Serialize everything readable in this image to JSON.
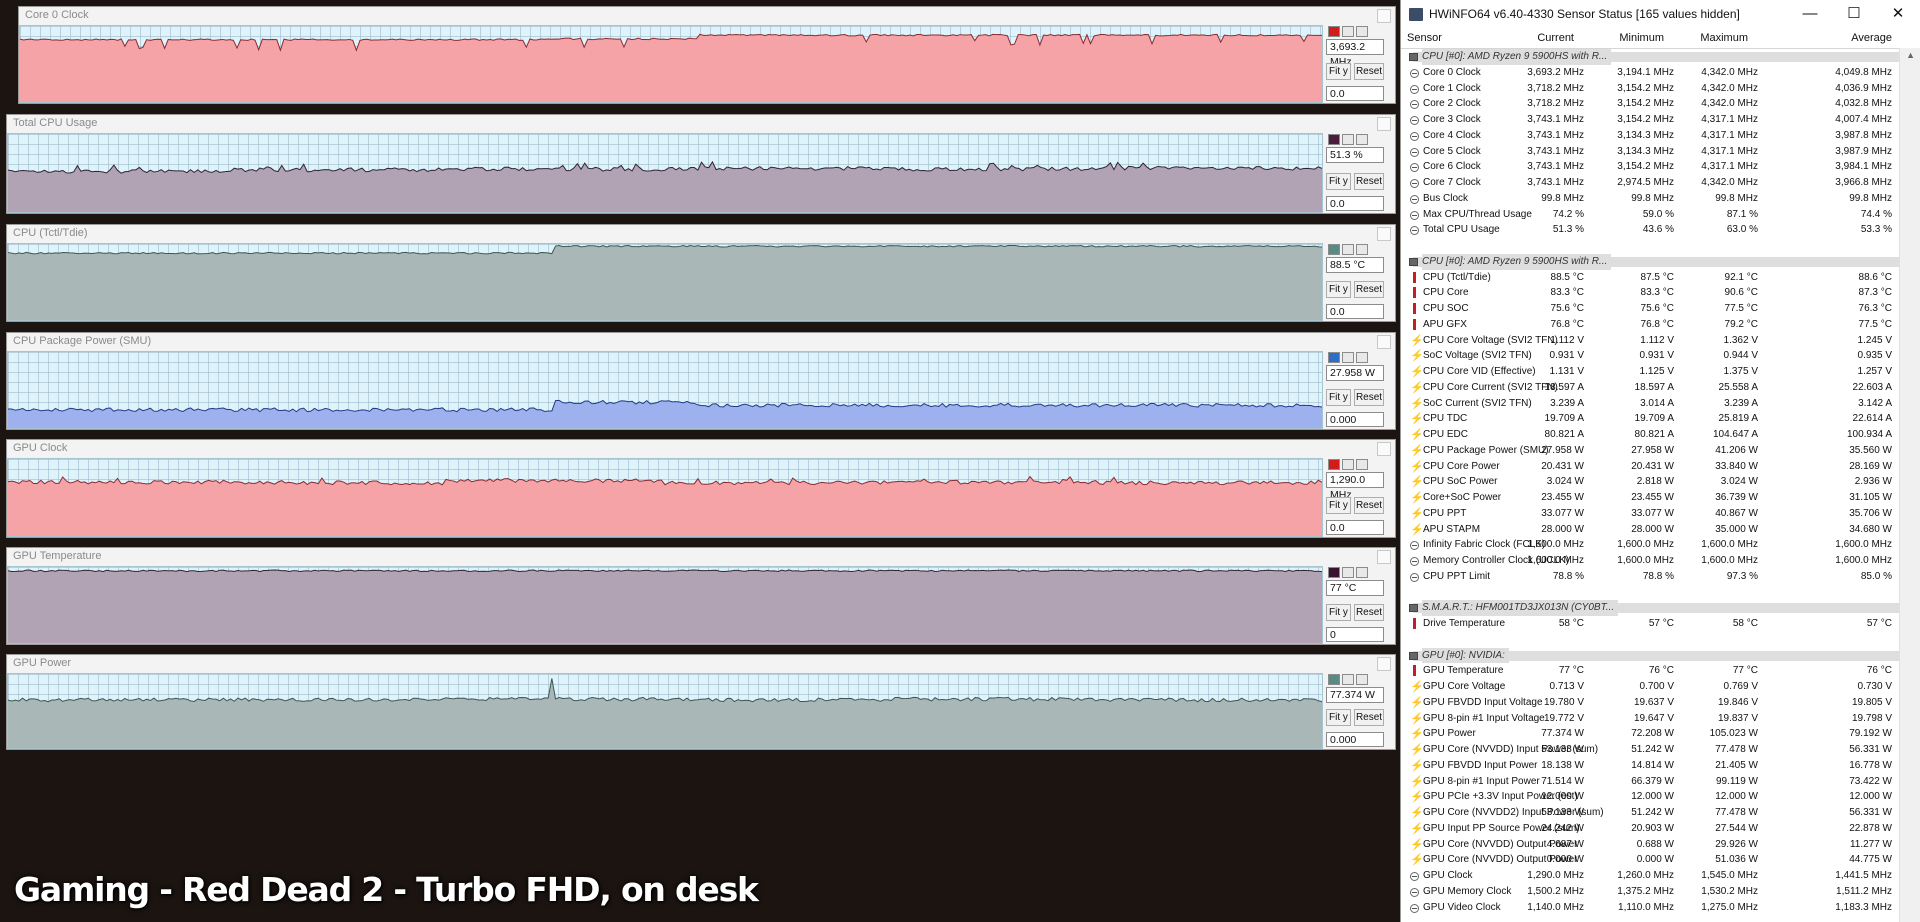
{
  "graphs": [
    {
      "title": "Core 0 Clock",
      "current": "3,693.2 MHz",
      "min": "0.0",
      "color": "#f5a3a6",
      "line": "#8a2b30",
      "swatch": "#d21c1c",
      "level": [
        0.18,
        0.18,
        0.17,
        0.11,
        0.12,
        0.12
      ]
    },
    {
      "title": "Total CPU Usage",
      "current": "51.3 %",
      "min": "0.0",
      "color": "#b2a3b4",
      "line": "#2e2434",
      "swatch": "#4a1e3a",
      "level": [
        0.48,
        0.46,
        0.45,
        0.44,
        0.45,
        0.44
      ]
    },
    {
      "title": "CPU (Tctl/Tdie)",
      "current": "88.5 °C",
      "min": "0.0",
      "color": "#a9b8b7",
      "line": "#3c5654",
      "swatch": "#5a8a86",
      "level": [
        0.12,
        0.11,
        0.03,
        0.02,
        0.03,
        0.03
      ]
    },
    {
      "title": "CPU Package Power (SMU)",
      "current": "27.958 W",
      "min": "0.000",
      "color": "#9db1ee",
      "line": "#233a88",
      "swatch": "#2e6ec6",
      "level": [
        0.76,
        0.76,
        0.66,
        0.7,
        0.7,
        0.71
      ]
    },
    {
      "title": "GPU Clock",
      "current": "1,290.0 MHz",
      "min": "0.0",
      "color": "#f5a3a6",
      "line": "#8a2b30",
      "swatch": "#d21c1c",
      "level": [
        0.3,
        0.31,
        0.28,
        0.31,
        0.3,
        0.31
      ]
    },
    {
      "title": "GPU Temperature",
      "current": "77 °C",
      "min": "0",
      "color": "#b2a3b4",
      "line": "#2e2434",
      "swatch": "#3a1230",
      "level": [
        0.05,
        0.05,
        0.05,
        0.05,
        0.05,
        0.05
      ]
    },
    {
      "title": "GPU Power",
      "current": "77.374 W",
      "min": "0.000",
      "color": "#a9b8b7",
      "line": "#3c5654",
      "swatch": "#5a8a86",
      "level": [
        0.35,
        0.35,
        0.34,
        0.35,
        0.34,
        0.35
      ]
    }
  ],
  "graph_buttons": {
    "fit": "Fit y",
    "reset": "Reset"
  },
  "caption": "Gaming - Red Dead 2 - Turbo FHD, on desk",
  "sensor": {
    "title": "HWiNFO64 v6.40-4330 Sensor Status [165 values hidden]",
    "columns": [
      "Sensor",
      "Current",
      "Minimum",
      "Maximum",
      "Average"
    ],
    "rows": [
      {
        "g": "CPU [#0]: AMD Ryzen 9 5900HS with R..."
      },
      {
        "n": "Core 0 Clock",
        "i": "clock",
        "v": [
          "3,693.2 MHz",
          "3,194.1 MHz",
          "4,342.0 MHz",
          "4,049.8 MHz"
        ]
      },
      {
        "n": "Core 1 Clock",
        "i": "clock",
        "v": [
          "3,718.2 MHz",
          "3,154.2 MHz",
          "4,342.0 MHz",
          "4,036.9 MHz"
        ]
      },
      {
        "n": "Core 2 Clock",
        "i": "clock",
        "v": [
          "3,718.2 MHz",
          "3,154.2 MHz",
          "4,342.0 MHz",
          "4,032.8 MHz"
        ]
      },
      {
        "n": "Core 3 Clock",
        "i": "clock",
        "v": [
          "3,743.1 MHz",
          "3,154.2 MHz",
          "4,317.1 MHz",
          "4,007.4 MHz"
        ]
      },
      {
        "n": "Core 4 Clock",
        "i": "clock",
        "v": [
          "3,743.1 MHz",
          "3,134.3 MHz",
          "4,317.1 MHz",
          "3,987.8 MHz"
        ]
      },
      {
        "n": "Core 5 Clock",
        "i": "clock",
        "v": [
          "3,743.1 MHz",
          "3,134.3 MHz",
          "4,317.1 MHz",
          "3,987.9 MHz"
        ]
      },
      {
        "n": "Core 6 Clock",
        "i": "clock",
        "v": [
          "3,743.1 MHz",
          "3,154.2 MHz",
          "4,317.1 MHz",
          "3,984.1 MHz"
        ]
      },
      {
        "n": "Core 7 Clock",
        "i": "clock",
        "v": [
          "3,743.1 MHz",
          "2,974.5 MHz",
          "4,342.0 MHz",
          "3,966.8 MHz"
        ]
      },
      {
        "n": "Bus Clock",
        "i": "clock",
        "v": [
          "99.8 MHz",
          "99.8 MHz",
          "99.8 MHz",
          "99.8 MHz"
        ]
      },
      {
        "n": "Max CPU/Thread Usage",
        "i": "clock",
        "v": [
          "74.2 %",
          "59.0 %",
          "87.1 %",
          "74.4 %"
        ]
      },
      {
        "n": "Total CPU Usage",
        "i": "clock",
        "v": [
          "51.3 %",
          "43.6 %",
          "63.0 %",
          "53.3 %"
        ]
      },
      {
        "blank": true
      },
      {
        "g": "CPU [#0]: AMD Ryzen 9 5900HS with R..."
      },
      {
        "n": "CPU (Tctl/Tdie)",
        "i": "therm",
        "v": [
          "88.5 °C",
          "87.5 °C",
          "92.1 °C",
          "88.6 °C"
        ]
      },
      {
        "n": "CPU Core",
        "i": "therm",
        "v": [
          "83.3 °C",
          "83.3 °C",
          "90.6 °C",
          "87.3 °C"
        ]
      },
      {
        "n": "CPU SOC",
        "i": "therm",
        "v": [
          "75.6 °C",
          "75.6 °C",
          "77.5 °C",
          "76.3 °C"
        ]
      },
      {
        "n": "APU GFX",
        "i": "therm",
        "v": [
          "76.8 °C",
          "76.8 °C",
          "79.2 °C",
          "77.5 °C"
        ]
      },
      {
        "n": "CPU Core Voltage (SVI2 TFN)",
        "i": "volt",
        "v": [
          "1.112 V",
          "1.112 V",
          "1.362 V",
          "1.245 V"
        ]
      },
      {
        "n": "SoC Voltage (SVI2 TFN)",
        "i": "volt",
        "v": [
          "0.931 V",
          "0.931 V",
          "0.944 V",
          "0.935 V"
        ]
      },
      {
        "n": "CPU Core VID (Effective)",
        "i": "volt",
        "v": [
          "1.131 V",
          "1.125 V",
          "1.375 V",
          "1.257 V"
        ]
      },
      {
        "n": "CPU Core Current (SVI2 TFN)",
        "i": "volt",
        "v": [
          "18.597 A",
          "18.597 A",
          "25.558 A",
          "22.603 A"
        ]
      },
      {
        "n": "SoC Current (SVI2 TFN)",
        "i": "volt",
        "v": [
          "3.239 A",
          "3.014 A",
          "3.239 A",
          "3.142 A"
        ]
      },
      {
        "n": "CPU TDC",
        "i": "volt",
        "v": [
          "19.709 A",
          "19.709 A",
          "25.819 A",
          "22.614 A"
        ]
      },
      {
        "n": "CPU EDC",
        "i": "volt",
        "v": [
          "80.821 A",
          "80.821 A",
          "104.647 A",
          "100.934 A"
        ]
      },
      {
        "n": "CPU Package Power (SMU)",
        "i": "volt",
        "v": [
          "27.958 W",
          "27.958 W",
          "41.206 W",
          "35.560 W"
        ]
      },
      {
        "n": "CPU Core Power",
        "i": "volt",
        "v": [
          "20.431 W",
          "20.431 W",
          "33.840 W",
          "28.169 W"
        ]
      },
      {
        "n": "CPU SoC Power",
        "i": "volt",
        "v": [
          "3.024 W",
          "2.818 W",
          "3.024 W",
          "2.936 W"
        ]
      },
      {
        "n": "Core+SoC Power",
        "i": "volt",
        "v": [
          "23.455 W",
          "23.455 W",
          "36.739 W",
          "31.105 W"
        ]
      },
      {
        "n": "CPU PPT",
        "i": "volt",
        "v": [
          "33.077 W",
          "33.077 W",
          "40.867 W",
          "35.706 W"
        ]
      },
      {
        "n": "APU STAPM",
        "i": "volt",
        "v": [
          "28.000 W",
          "28.000 W",
          "35.000 W",
          "34.680 W"
        ]
      },
      {
        "n": "Infinity Fabric Clock (FCLK)",
        "i": "clock",
        "v": [
          "1,600.0 MHz",
          "1,600.0 MHz",
          "1,600.0 MHz",
          "1,600.0 MHz"
        ]
      },
      {
        "n": "Memory Controller Clock (UCLK)",
        "i": "clock",
        "v": [
          "1,600.0 MHz",
          "1,600.0 MHz",
          "1,600.0 MHz",
          "1,600.0 MHz"
        ]
      },
      {
        "n": "CPU PPT Limit",
        "i": "clock",
        "v": [
          "78.8 %",
          "78.8 %",
          "97.3 %",
          "85.0 %"
        ]
      },
      {
        "blank": true
      },
      {
        "g": "S.M.A.R.T.: HFM001TD3JX013N (CY0BT..."
      },
      {
        "n": "Drive Temperature",
        "i": "therm",
        "v": [
          "58 °C",
          "57 °C",
          "58 °C",
          "57 °C"
        ]
      },
      {
        "blank": true
      },
      {
        "g": "GPU [#0]: NVIDIA:"
      },
      {
        "n": "GPU Temperature",
        "i": "therm",
        "v": [
          "77 °C",
          "76 °C",
          "77 °C",
          "76 °C"
        ]
      },
      {
        "n": "GPU Core Voltage",
        "i": "volt",
        "v": [
          "0.713 V",
          "0.700 V",
          "0.769 V",
          "0.730 V"
        ]
      },
      {
        "n": "GPU FBVDD Input Voltage",
        "i": "volt",
        "v": [
          "19.780 V",
          "19.637 V",
          "19.846 V",
          "19.805 V"
        ]
      },
      {
        "n": "GPU 8-pin #1 Input Voltage",
        "i": "volt",
        "v": [
          "19.772 V",
          "19.647 V",
          "19.837 V",
          "19.798 V"
        ]
      },
      {
        "n": "GPU Power",
        "i": "volt",
        "v": [
          "77.374 W",
          "72.208 W",
          "105.023 W",
          "79.192 W"
        ]
      },
      {
        "n": "GPU Core (NVVDD) Input Power (sum)",
        "i": "volt",
        "v": [
          "53.133 W",
          "51.242 W",
          "77.478 W",
          "56.331 W"
        ]
      },
      {
        "n": "GPU FBVDD Input Power",
        "i": "volt",
        "v": [
          "18.138 W",
          "14.814 W",
          "21.405 W",
          "16.778 W"
        ]
      },
      {
        "n": "GPU 8-pin #1 Input Power",
        "i": "volt",
        "v": [
          "71.514 W",
          "66.379 W",
          "99.119 W",
          "73.422 W"
        ]
      },
      {
        "n": "GPU PCIe +3.3V Input Power (est)",
        "i": "volt",
        "v": [
          "12.000 W",
          "12.000 W",
          "12.000 W",
          "12.000 W"
        ]
      },
      {
        "n": "GPU Core (NVVDD2) Input Power (sum)",
        "i": "volt",
        "v": [
          "53.133 W",
          "51.242 W",
          "77.478 W",
          "56.331 W"
        ]
      },
      {
        "n": "GPU Input PP Source Power (sum)",
        "i": "volt",
        "v": [
          "24.242 W",
          "20.903 W",
          "27.544 W",
          "22.878 W"
        ]
      },
      {
        "n": "GPU Core (NVVDD) Output Power",
        "i": "volt",
        "v": [
          "4.687 W",
          "0.688 W",
          "29.926 W",
          "11.277 W"
        ]
      },
      {
        "n": "GPU Core (NVVDD) Output Power",
        "i": "volt",
        "v": [
          "0.000 W",
          "0.000 W",
          "51.036 W",
          "44.775 W"
        ]
      },
      {
        "n": "GPU Clock",
        "i": "clock",
        "v": [
          "1,290.0 MHz",
          "1,260.0 MHz",
          "1,545.0 MHz",
          "1,441.5 MHz"
        ]
      },
      {
        "n": "GPU Memory Clock",
        "i": "clock",
        "v": [
          "1,500.2 MHz",
          "1,375.2 MHz",
          "1,530.2 MHz",
          "1,511.2 MHz"
        ]
      },
      {
        "n": "GPU Video Clock",
        "i": "clock",
        "v": [
          "1,140.0 MHz",
          "1,110.0 MHz",
          "1,275.0 MHz",
          "1,183.3 MHz"
        ]
      }
    ]
  }
}
